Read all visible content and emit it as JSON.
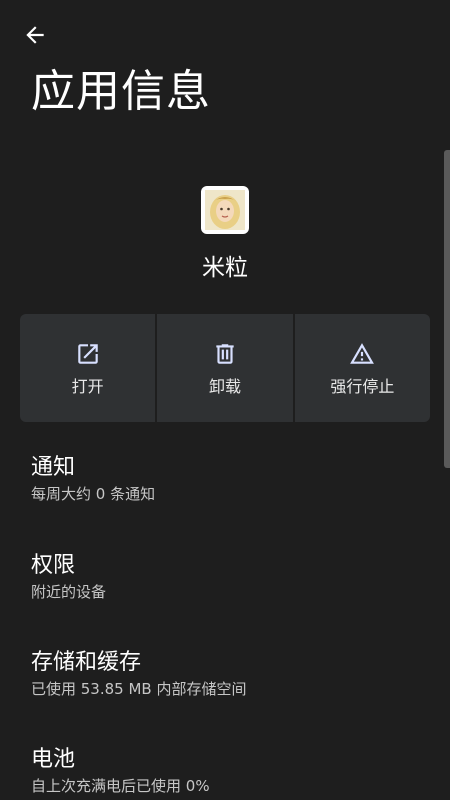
{
  "header": {
    "back_icon": "arrow-back-icon",
    "title": "应用信息"
  },
  "app": {
    "icon": "app-icon",
    "name": "米粒"
  },
  "actions": [
    {
      "label": "打开",
      "icon": "open-external-icon"
    },
    {
      "label": "卸载",
      "icon": "trash-icon"
    },
    {
      "label": "强行停止",
      "icon": "warning-icon"
    }
  ],
  "settings": [
    {
      "title": "通知",
      "summary": "每周大约 0 条通知"
    },
    {
      "title": "权限",
      "summary": "附近的设备"
    },
    {
      "title": "存储和缓存",
      "summary": "已使用 53.85 MB 内部存储空间"
    },
    {
      "title": "电池",
      "summary": "自上次充满电后已使用 0%"
    }
  ],
  "colors": {
    "background": "#1e1e1e",
    "action_background": "#2f3133",
    "primary_text": "#ffffff",
    "secondary_text": "#c6c6c6"
  }
}
